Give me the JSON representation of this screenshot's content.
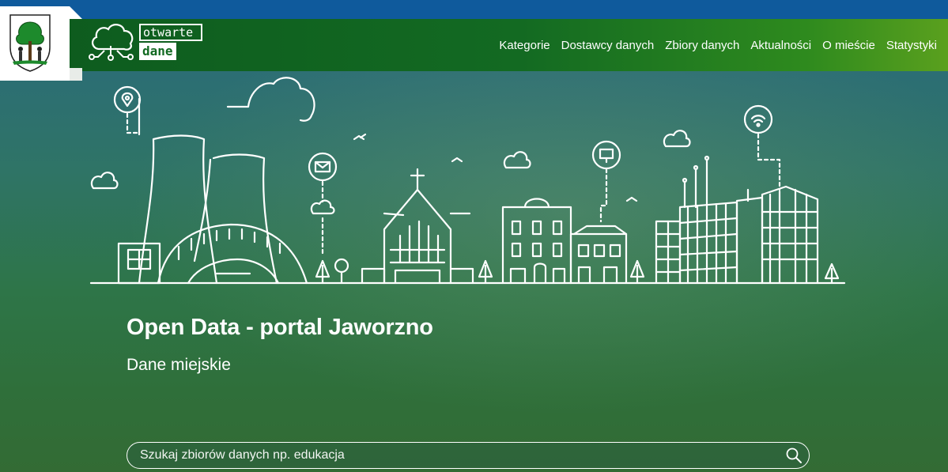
{
  "brand": {
    "line1": "otwarte",
    "line2": "dane"
  },
  "nav": {
    "items": [
      {
        "label": "Kategorie"
      },
      {
        "label": "Dostawcy danych"
      },
      {
        "label": "Zbiory danych"
      },
      {
        "label": "Aktualności"
      },
      {
        "label": "O mieście"
      },
      {
        "label": "Statystyki"
      }
    ]
  },
  "hero": {
    "title": "Open Data - portal Jaworzno",
    "subtitle": "Dane miejskie"
  },
  "search": {
    "placeholder": "Szukaj zbiorów danych np. edukacja"
  },
  "colors": {
    "topbar": "#0f5a9c",
    "navbar": "#136a22",
    "accent": "#5aa01e"
  },
  "icons": [
    "city-crest-icon",
    "cloud-network-logo-icon",
    "search-icon",
    "location-pin-icon",
    "mail-icon",
    "monitor-icon",
    "wifi-icon"
  ]
}
